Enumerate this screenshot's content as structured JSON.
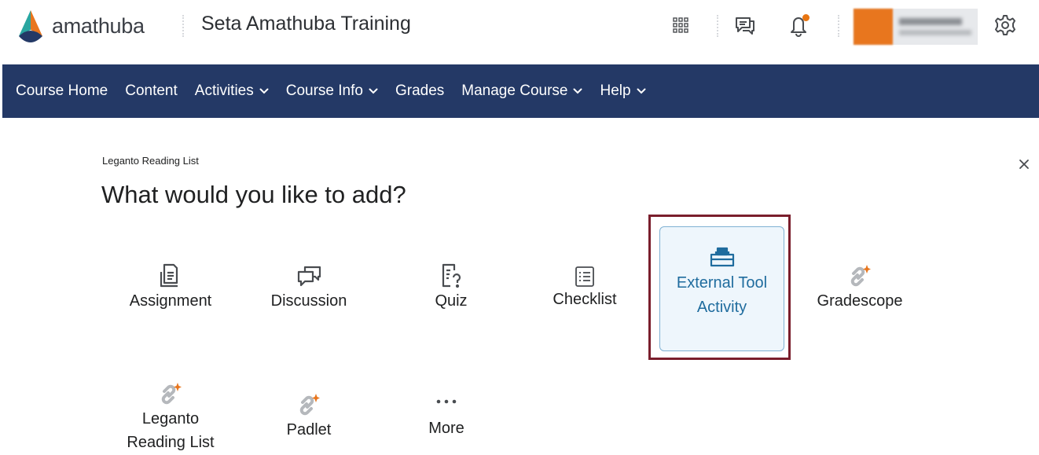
{
  "header": {
    "logo_text": "amathuba",
    "course_title": "Seta Amathuba Training",
    "icons": [
      "app-grid-icon",
      "message-alerts-icon",
      "notification-bell-icon",
      "settings-gear-icon"
    ],
    "brand_color": "#243966",
    "notification_dot_color": "#e87511"
  },
  "nav": {
    "items": [
      {
        "label": "Course Home",
        "has_menu": false
      },
      {
        "label": "Content",
        "has_menu": false
      },
      {
        "label": "Activities",
        "has_menu": true
      },
      {
        "label": "Course Info",
        "has_menu": true
      },
      {
        "label": "Grades",
        "has_menu": false
      },
      {
        "label": "Manage Course",
        "has_menu": true
      },
      {
        "label": "Help",
        "has_menu": true
      }
    ]
  },
  "dialog": {
    "breadcrumb": "Leganto Reading List",
    "title": "What would you like to add?",
    "close_icon": "close-icon",
    "tiles": [
      {
        "label": "Assignment",
        "icon": "assignment-icon"
      },
      {
        "label": "Discussion",
        "icon": "discussion-icon"
      },
      {
        "label": "Quiz",
        "icon": "quiz-icon"
      },
      {
        "label": "Checklist",
        "icon": "checklist-icon"
      },
      {
        "label_line1": "External Tool",
        "label_line2": "Activity",
        "icon": "external-tool-icon",
        "selected": true
      },
      {
        "label": "Gradescope",
        "icon": "link-plugin-icon"
      },
      {
        "label_line1": "Leganto",
        "label_line2": "Reading List",
        "icon": "link-plugin-icon"
      },
      {
        "label": "Padlet",
        "icon": "link-plugin-icon"
      },
      {
        "label": "More",
        "icon": "more-dots-icon"
      }
    ]
  }
}
